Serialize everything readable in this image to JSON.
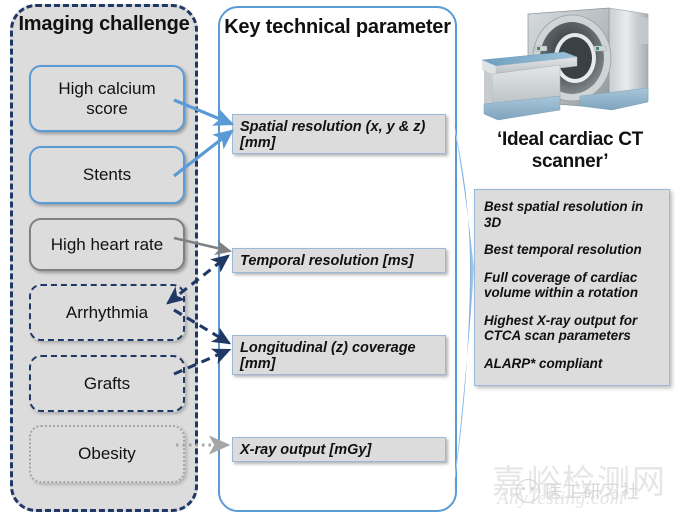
{
  "left_panel": {
    "title": "Imaging challenge",
    "items": [
      {
        "label": "High calcium score",
        "border": "solid-blue"
      },
      {
        "label": "Stents",
        "border": "solid-blue"
      },
      {
        "label": "High heart rate",
        "border": "solid-gray"
      },
      {
        "label": "Arrhythmia",
        "border": "dashed-navy"
      },
      {
        "label": "Grafts",
        "border": "dashed-navy"
      },
      {
        "label": "Obesity",
        "border": "dotted-gray"
      }
    ]
  },
  "middle_panel": {
    "title": "Key technical parameter",
    "items": [
      {
        "label": "Spatial resolution (x, y & z)[mm]"
      },
      {
        "label": "Temporal resolution [ms]"
      },
      {
        "label": "Longitudinal (z) coverage [mm]"
      },
      {
        "label": "X-ray output [mGy]"
      }
    ]
  },
  "right_panel": {
    "image_caption": "‘Ideal cardiac CT scanner’",
    "scanner_icon": "ct-scanner-icon",
    "features": [
      "Best spatial resolution in 3D",
      "Best temporal resolution",
      "Full coverage of cardiac volume within a rotation",
      "Highest X-ray output for CTCA scan parameters",
      "ALARP* compliant"
    ]
  },
  "connectors": [
    {
      "from": "High calcium score",
      "to": "Spatial resolution (x, y & z)[mm]",
      "style": "solid",
      "color": "#5b9bd5",
      "heads": "end"
    },
    {
      "from": "Stents",
      "to": "Spatial resolution (x, y & z)[mm]",
      "style": "solid",
      "color": "#5b9bd5",
      "heads": "end"
    },
    {
      "from": "High heart rate",
      "to": "Temporal resolution [ms]",
      "style": "solid",
      "color": "#808080",
      "heads": "end"
    },
    {
      "from": "Arrhythmia",
      "to": "Temporal resolution [ms]",
      "style": "dashed",
      "color": "#1f3864",
      "heads": "both"
    },
    {
      "from": "Arrhythmia",
      "to": "Longitudinal (z) coverage [mm]",
      "style": "dashed",
      "color": "#1f3864",
      "heads": "end"
    },
    {
      "from": "Grafts",
      "to": "Longitudinal (z) coverage [mm]",
      "style": "dashed",
      "color": "#1f3864",
      "heads": "end"
    },
    {
      "from": "Obesity",
      "to": "X-ray output [mGy]",
      "style": "dotted",
      "color": "#a6a6a6",
      "heads": "end"
    }
  ],
  "flow_arrow": {
    "name": "lens-arrow",
    "color": "#5b9bd5"
  },
  "watermarks": {
    "cn_site": "嘉峪检测网",
    "en_site": "AnyTesting.com",
    "badge_text": "医工研习社"
  },
  "colors": {
    "accent_blue": "#5b9bd5",
    "navy": "#1f3864",
    "panel_gray": "#dcdcdc",
    "gray_line": "#808080",
    "dotted_gray": "#a6a6a6"
  }
}
